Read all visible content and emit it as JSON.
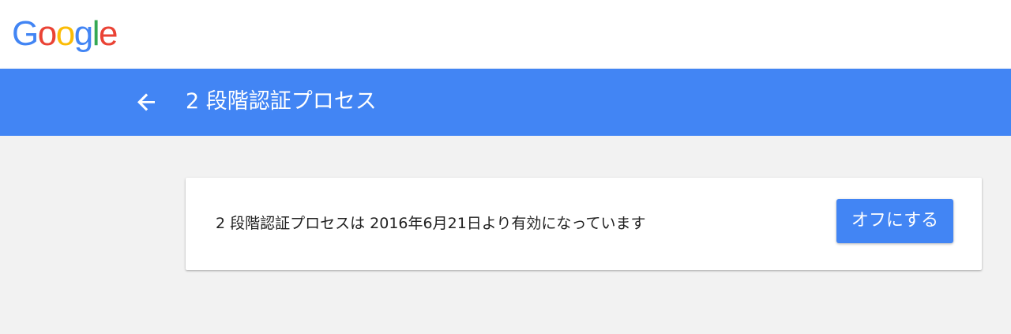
{
  "logo": {
    "letters": [
      "G",
      "o",
      "o",
      "g",
      "l",
      "e"
    ],
    "colors": [
      "#4285f4",
      "#ea4335",
      "#fbbc05",
      "#4285f4",
      "#34a853",
      "#ea4335"
    ]
  },
  "header": {
    "back_icon": "arrow-left-icon",
    "title": "2 段階認証プロセス",
    "background_color": "#4285f4"
  },
  "card": {
    "status_text": "2 段階認証プロセスは 2016年6月21日より有効になっています",
    "turn_off_label": "オフにする",
    "button_color": "#4285f4"
  }
}
